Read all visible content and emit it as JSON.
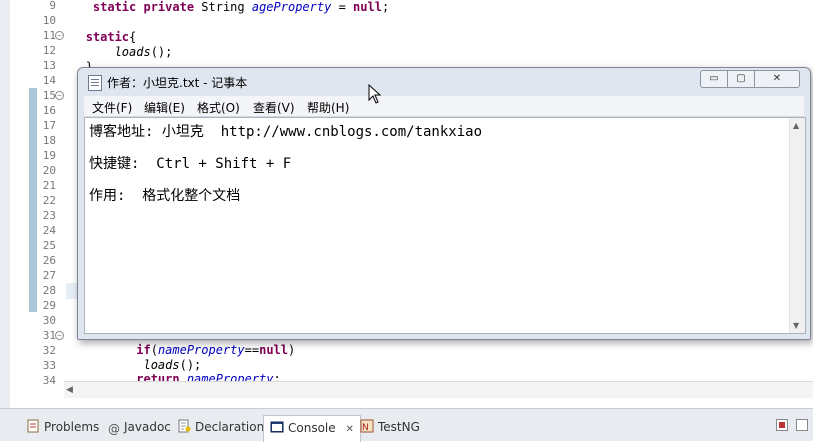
{
  "editor": {
    "lines": [
      {
        "n": "9"
      },
      {
        "n": "10"
      },
      {
        "n": "11"
      },
      {
        "n": "12"
      },
      {
        "n": "13"
      },
      {
        "n": "14"
      },
      {
        "n": "15"
      },
      {
        "n": "16"
      },
      {
        "n": "17"
      },
      {
        "n": "18"
      },
      {
        "n": "19"
      },
      {
        "n": "20"
      },
      {
        "n": "21"
      },
      {
        "n": "22"
      },
      {
        "n": "23"
      },
      {
        "n": "24"
      },
      {
        "n": "25"
      },
      {
        "n": "26"
      },
      {
        "n": "27"
      },
      {
        "n": "28"
      },
      {
        "n": "29"
      },
      {
        "n": "30"
      },
      {
        "n": "31"
      },
      {
        "n": "32"
      },
      {
        "n": "33"
      },
      {
        "n": "34"
      }
    ],
    "code": {
      "l9_kw": "static private",
      "l9_type": " String ",
      "l9_var": "ageProperty",
      "l9_eq": " = ",
      "l9_null": "null",
      "l9_end": ";",
      "l11_kw": "static",
      "l11_brace": "{",
      "l12_call": "loads",
      "l12_end": "();",
      "l13_brace": "}",
      "l32_kw": "if",
      "l32_open": "(",
      "l32_var": "nameProperty",
      "l32_op": "==",
      "l32_null": "null",
      "l32_close": ")",
      "l33_call": "loads",
      "l33_end": "();",
      "l34_kw": "return",
      "l34_var": " nameProperty",
      "l34_end": ";"
    }
  },
  "notepad": {
    "title": "作者：小坦克.txt - 记事本",
    "menu": [
      "文件(F)",
      "编辑(E)",
      "格式(O)",
      "查看(V)",
      "帮助(H)"
    ],
    "content": [
      "博客地址: 小坦克  http://www.cnblogs.com/tankxiao",
      "快捷键:  Ctrl + Shift + F",
      "作用:  格式化整个文档"
    ],
    "buttons": {
      "minimize": "▭",
      "maximize": "▢",
      "close": "✕"
    }
  },
  "views": {
    "tabs": [
      "Problems",
      "Javadoc",
      "Declaration",
      "Console",
      "TestNG"
    ],
    "active": "Console",
    "close_glyph": "✕"
  },
  "colors": {
    "keyword": "#7f0055",
    "field": "#0000c0",
    "changebar": "#aac8d8"
  }
}
